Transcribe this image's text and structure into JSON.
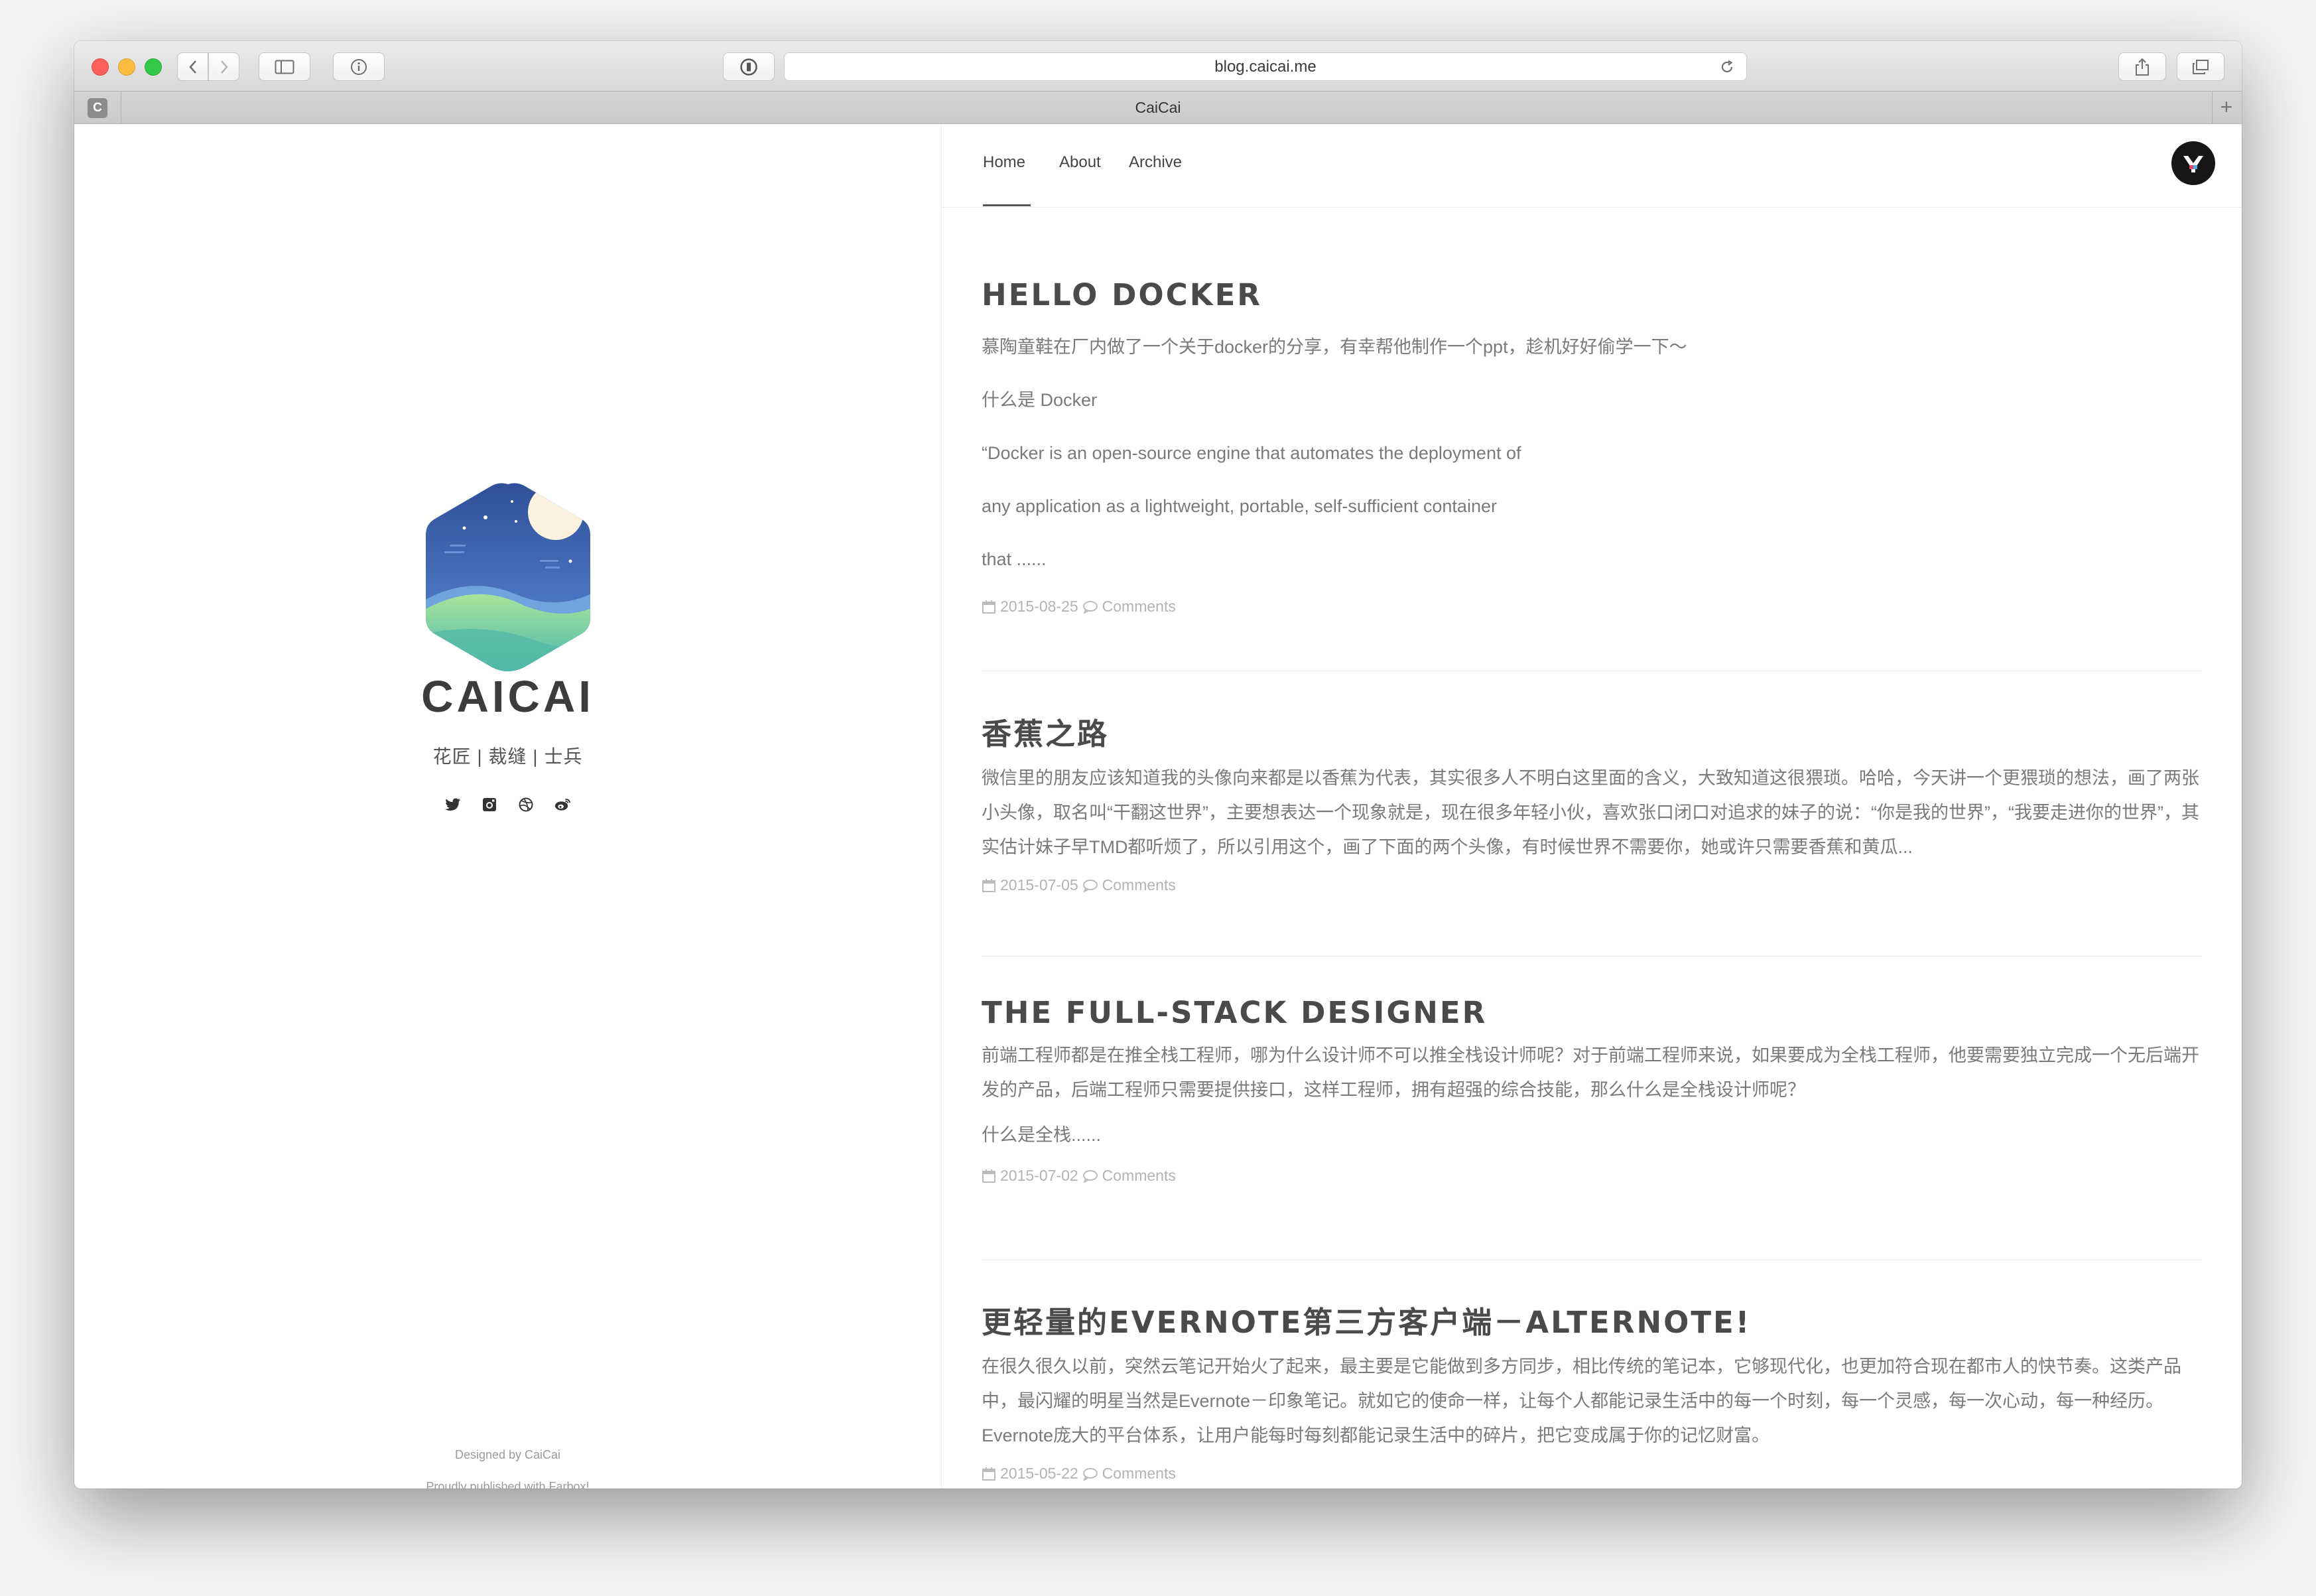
{
  "browser": {
    "url": "blog.caicai.me",
    "tab_title": "CaiCai",
    "tab_favicon": "C"
  },
  "sidebar": {
    "site_name": "CAICAI",
    "tagline": "花匠 | 裁缝 | 士兵",
    "social_icons": [
      "twitter-icon",
      "instagram-icon",
      "dribbble-icon",
      "weibo-icon"
    ],
    "credit_designed": "Designed by CaiCai",
    "credit_published": "Proudly published with Farbox!"
  },
  "nav": {
    "items": [
      {
        "label": "Home",
        "active": true
      },
      {
        "label": "About"
      },
      {
        "label": "Archive"
      }
    ]
  },
  "posts": [
    {
      "title": "HELLO DOCKER",
      "lines": [
        "慕陶童鞋在厂内做了一个关于docker的分享，有幸帮他制作一个ppt，趁机好好偷学一下〜",
        "什么是 Docker",
        "“Docker is an open-source engine that automates the deployment of",
        "any application as a lightweight, portable, self-sufficient container",
        "that ......"
      ],
      "date": "2015-08-25",
      "comments": "Comments"
    },
    {
      "title": "香蕉之路",
      "paragraph": "微信里的朋友应该知道我的头像向来都是以香蕉为代表，其实很多人不明白这里面的含义，大致知道这很猥琐。哈哈，今天讲一个更猥琐的想法，画了两张小头像，取名叫“干翻这世界”，主要想表达一个现象就是，现在很多年轻小伙，喜欢张口闭口对追求的妹子的说：“你是我的世界”，“我要走进你的世界”，其实估计妹子早TMD都听烦了，所以引用这个，画了下面的两个头像，有时候世界不需要你，她或许只需要香蕉和黄瓜...",
      "date": "2015-07-05",
      "comments": "Comments"
    },
    {
      "title": "THE FULL-STACK DESIGNER",
      "paragraph": "前端工程师都是在推全栈工程师，哪为什么设计师不可以推全栈设计师呢？对于前端工程师来说，如果要成为全栈工程师，他要需要独立完成一个无后端开发的产品，后端工程师只需要提供接口，这样工程师，拥有超强的综合技能，那么什么是全栈设计师呢？",
      "extra": "什么是全栈......",
      "date": "2015-07-02",
      "comments": "Comments"
    },
    {
      "title": "更轻量的EVERNOTE第三方客户端－ALTERNOTE!",
      "paragraph": "在很久很久以前，突然云笔记开始火了起来，最主要是它能做到多方同步，相比传统的笔记本，它够现代化，也更加符合现在都市人的快节奏。这类产品中，最闪耀的明星当然是Evernote－印象笔记。就如它的使命一样，让每个人都能记录生活中的每一个时刻，每一个灵感，每一次心动，每一种经历。Evernote庞大的平台体系，让用户能每时每刻都能记录生活中的碎片，把它变成属于你的记忆财富。",
      "date": "2015-05-22",
      "comments": "Comments"
    }
  ]
}
